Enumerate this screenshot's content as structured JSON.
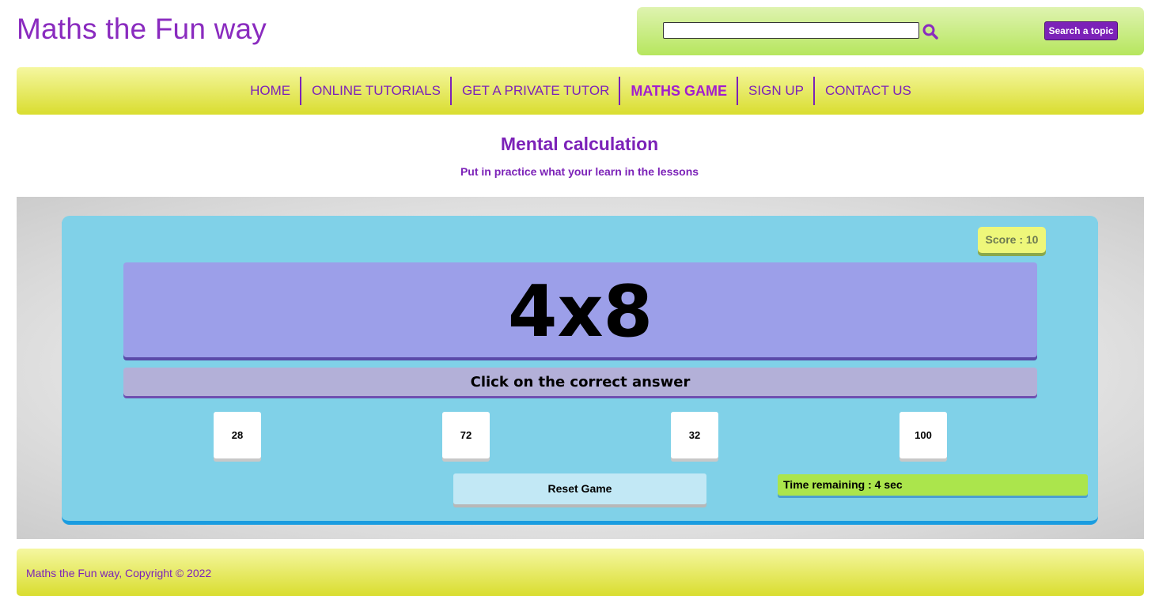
{
  "site": {
    "title": "Maths the Fun way"
  },
  "search": {
    "placeholder": "",
    "value": "",
    "button_label": "Search a topic",
    "icon": "search-icon"
  },
  "nav": {
    "items": [
      {
        "label": "HOME",
        "active": false
      },
      {
        "label": "ONLINE TUTORIALS",
        "active": false
      },
      {
        "label": "GET A PRIVATE TUTOR",
        "active": false
      },
      {
        "label": "MATHS GAME",
        "active": true
      },
      {
        "label": "SIGN UP",
        "active": false
      },
      {
        "label": "CONTACT US",
        "active": false
      }
    ]
  },
  "page": {
    "heading": "Mental calculation",
    "subheading": "Put in practice what your learn in the lessons"
  },
  "game": {
    "score_label": "Score : 10",
    "question": "4x8",
    "instruction": "Click on the correct answer",
    "answers": [
      "28",
      "72",
      "32",
      "100"
    ],
    "reset_label": "Reset Game",
    "time_label": "Time remaining : 4 sec"
  },
  "footer": {
    "text": "Maths the Fun way, Copyright © 2022"
  },
  "colors": {
    "brand_purple": "#7c22b8",
    "nav_yellow": "#d9dd2f",
    "panel_blue": "#80d1e8",
    "question_bg": "#9c9fe9",
    "time_green": "#abe54c",
    "score_yellow": "#eef77a"
  }
}
